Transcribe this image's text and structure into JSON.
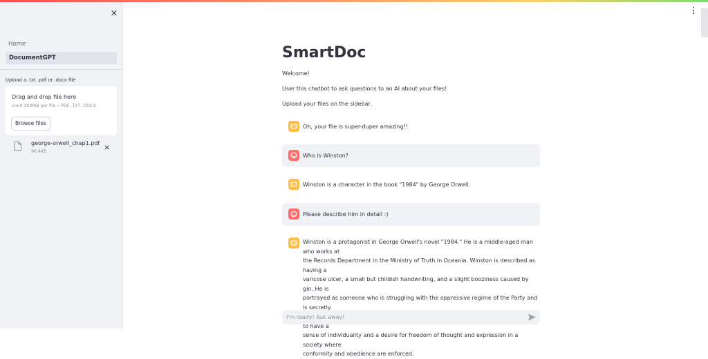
{
  "sidebar": {
    "nav_home": "Home",
    "nav_document": "DocumentGPT",
    "upload_label": "Upload a .txt .pdf or .docx file",
    "dropzone_title": "Drag and drop file here",
    "dropzone_limit": "Limit 200MB per file • PDF, TXT, DOCX",
    "browse_label": "Browse files",
    "file": {
      "name": "george-orwell_chap1.pdf",
      "size": "96.4KB"
    },
    "close_icon": "×",
    "remove_icon": "×"
  },
  "main": {
    "title": "SmartDoc",
    "intro": [
      "Welcome!",
      "User this chatbot to ask questions to an AI about your files!",
      "Upload your files on the sidebar."
    ],
    "messages": [
      {
        "role": "bot",
        "text": "Oh, your file is super-duper amazing!!"
      },
      {
        "role": "user",
        "text": "Who is Winston?"
      },
      {
        "role": "bot",
        "text": "Winston is a character in the book \"1984\" by George Orwell."
      },
      {
        "role": "user",
        "text": "Please describe him in detail :)"
      },
      {
        "role": "bot",
        "lines": [
          "Winston is a protagonist in George Orwell's novel \"1984.\" He is a middle-aged man who works at",
          "the Records Department in the Ministry of Truth in Oceania. Winston is described as having a",
          "varicose ulcer, a small but childish handwriting, and a slight booziness caused by gin. He is",
          "portrayed as someone who is struggling with the oppressive regime of the Party and is secretly",
          "rebellious against the totalitarian government led by Big Brother. Winston is shown to have a",
          "sense of individuality and a desire for freedom of thought and expression in a society where",
          "conformity and obedience are enforced."
        ]
      }
    ],
    "chat_placeholder": "I'm ready! Ask away!"
  },
  "colors": {
    "sidebar_bg": "#f0f2f6",
    "bot_avatar": "#ffbd45",
    "user_avatar": "#ff6c6c",
    "user_bubble": "#f0f2f6"
  },
  "icons": {
    "close": "close-icon",
    "file": "file-icon",
    "remove": "remove-file-icon",
    "menu": "kebab-menu-icon",
    "bot": "bot-avatar-icon",
    "user": "user-avatar-icon",
    "send": "send-icon"
  }
}
